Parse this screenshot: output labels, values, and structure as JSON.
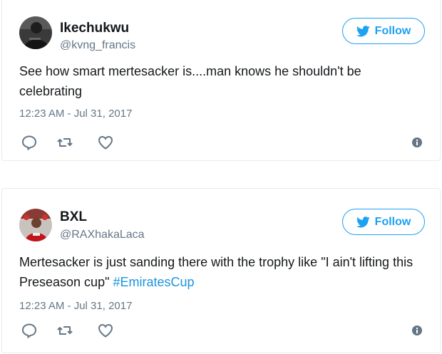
{
  "colors": {
    "accent": "#1da1f2",
    "hashtag": "#1b95e0",
    "muted": "#657786",
    "text": "#14171a"
  },
  "tweets": [
    {
      "display_name": "Ikechukwu",
      "handle": "@kvng_francis",
      "follow_label": "Follow",
      "text": "See how smart mertesacker is....man knows he shouldn't be celebrating",
      "timestamp": "12:23 AM - Jul 31, 2017",
      "icons": [
        "reply-icon",
        "retweet-icon",
        "like-icon",
        "info-icon"
      ]
    },
    {
      "display_name": "BXL",
      "handle": "@RAXhakaLaca",
      "follow_label": "Follow",
      "text": "Mertesacker is just sanding there with the trophy like \"I ain't lifting this Preseason cup\" ",
      "hashtag": "#EmiratesCup",
      "timestamp": "12:23 AM - Jul 31, 2017",
      "icons": [
        "reply-icon",
        "retweet-icon",
        "like-icon",
        "info-icon"
      ]
    }
  ]
}
